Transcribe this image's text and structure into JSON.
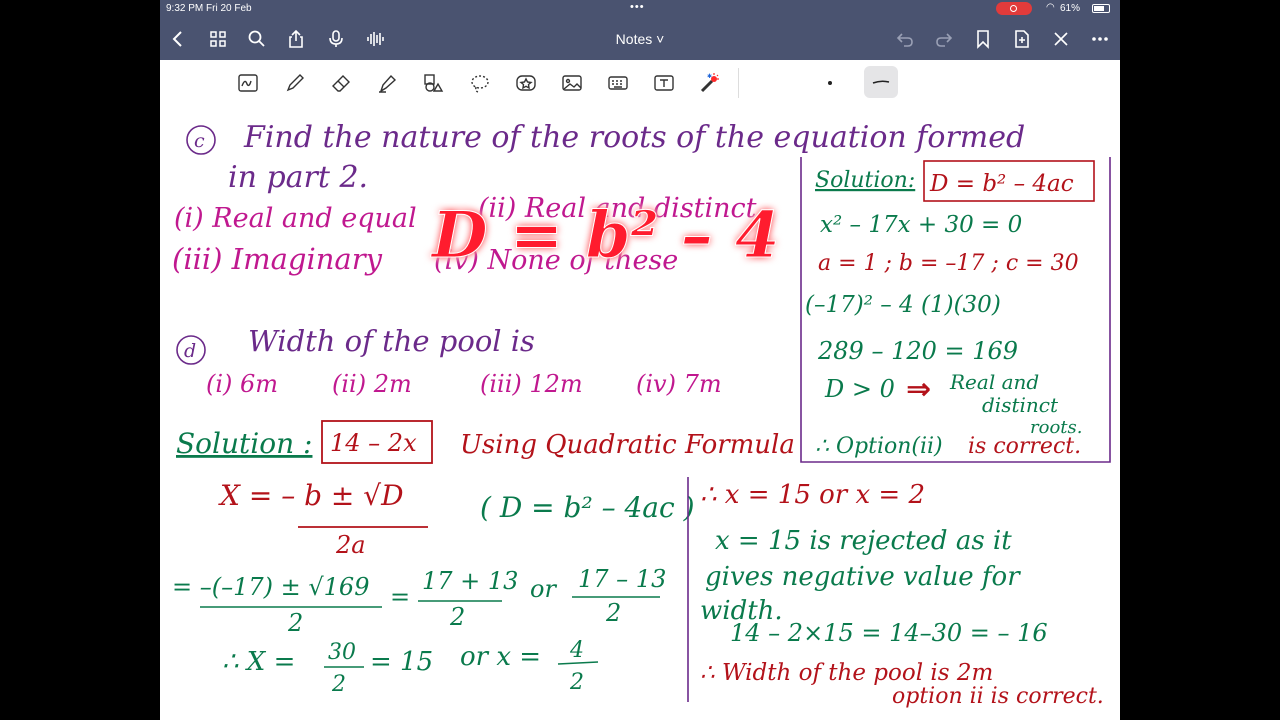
{
  "status_bar": {
    "time": "9:32 PM   Fri 20 Feb",
    "battery": "61%",
    "dots": "•••"
  },
  "nav": {
    "title": "Notes ˅",
    "icons": [
      "back-icon",
      "grid-icon",
      "search-icon",
      "share-icon",
      "mic-icon",
      "waveform-icon",
      "undo-icon",
      "redo-icon",
      "bookmark-icon",
      "add-page-icon",
      "close-icon",
      "more-icon"
    ]
  },
  "toolbar": {
    "tools": [
      "lasso-text-icon",
      "pen-icon",
      "eraser-icon",
      "highlighter-icon",
      "shapes-icon",
      "lasso-icon",
      "sticker-icon",
      "image-icon",
      "keyboard-icon",
      "textbox-icon",
      "laser-pointer-icon"
    ]
  },
  "colors": {
    "purple": "#6b2a8a",
    "magenta": "#c0188f",
    "green": "#0a7a4c",
    "red": "#b3121a",
    "laser": "#ff1f2d",
    "chrome": "#4a5370"
  },
  "notes": {
    "q_c_label": "c",
    "q_c_line1": "Find the nature of the roots of the equation formed",
    "q_c_line2": "in part 2.",
    "q_c_opt1": "(i) Real and equal",
    "q_c_opt2": "(ii) Real and distinct",
    "q_c_opt3": "(iii) Imaginary",
    "q_c_opt4": "(iv) None of these",
    "laser_text": "D = b² – 4",
    "q_d_label": "d",
    "q_d_text": "Width of the pool is",
    "q_d_opt1": "(i) 6m",
    "q_d_opt2": "(ii) 2m",
    "q_d_opt3": "(iii) 12m",
    "q_d_opt4": "(iv) 7m",
    "sol_right_label": "Solution:",
    "sol_right_formula": "D = b² – 4ac",
    "sol_right_l1": "x² – 17x + 30 = 0",
    "sol_right_l2": "a = 1 ; b = –17 ; c = 30",
    "sol_right_l3": "(–17)² – 4 (1)(30)",
    "sol_right_l4": "289 – 120  =  169",
    "sol_right_l5": "D > 0",
    "sol_right_l6a": "Real and",
    "sol_right_l6b": "distinct",
    "sol_right_l6c": "roots.",
    "sol_right_l7a": "∴ Option(ii)",
    "sol_right_l7b": "is correct.",
    "sol_bottom_label": "Solution :",
    "sol_bottom_box": "14 – 2x",
    "sol_bottom_using": "Using Quadratic Formula",
    "formula_num": "X = – b ± √D",
    "formula_den": "2a",
    "formula_disc": "( D = b² – 4ac )",
    "step1_num": "= –(–17) ± √169",
    "step1_den": "2",
    "step1_eq": "=",
    "step1_a_num": "17 + 13",
    "step1_a_den": "2",
    "step1_or": "or",
    "step1_b_num": "17 – 13",
    "step1_b_den": "2",
    "step2_a": "∴  X =",
    "step2_a_num": "30",
    "step2_a_den": "2",
    "step2_a_res": "= 15",
    "step2_or": "or  x =",
    "step2_b_num": "4",
    "step2_b_den": "2",
    "br_l1": "∴  x = 15  or  x = 2",
    "br_l2": "x = 15 is rejected as it",
    "br_l3": "gives negative value for",
    "br_l4": "width.",
    "br_l5": "14 – 2×15 = 14–30 = – 16",
    "br_l6": "∴ Width of the pool is 2m",
    "br_l7": "option ii is correct."
  }
}
